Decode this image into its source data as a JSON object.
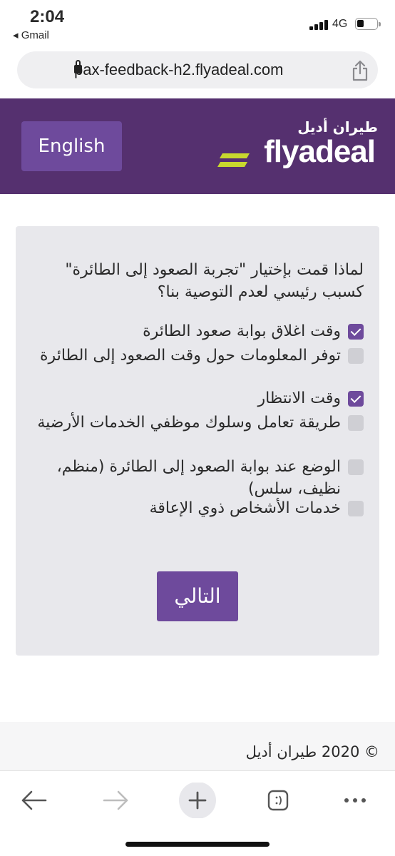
{
  "status_bar": {
    "time": "2:04",
    "back_app": "◂ Gmail",
    "network": "4G"
  },
  "browser": {
    "url": "pax-feedback-h2.flyadeal.com"
  },
  "header": {
    "language_button": "English",
    "logo_arabic": "طيران أديل",
    "logo_text": "flyadeal",
    "brand_color": "#55306f",
    "accent_color": "#c8d82e"
  },
  "survey": {
    "question": "لماذا قمت بإختيار \"تجربة الصعود إلى الطائرة\" كسبب رئيسي لعدم التوصية بنا؟",
    "options": [
      {
        "label": "وقت اغلاق بوابة صعود الطائرة",
        "checked": true
      },
      {
        "label": "توفر المعلومات حول وقت الصعود إلى الطائرة",
        "checked": false
      },
      {
        "label": "وقت الانتظار",
        "checked": true
      },
      {
        "label": "طريقة تعامل وسلوك موظفي الخدمات الأرضية",
        "checked": false
      },
      {
        "label": "الوضع عند بوابة الصعود إلى الطائرة (منظم، نظيف، سلس)",
        "checked": false
      },
      {
        "label": "خدمات الأشخاص ذوي الإعاقة",
        "checked": false
      }
    ],
    "next_button": "التالي"
  },
  "footer": {
    "copyright": "© 2020 طيران أديل"
  }
}
